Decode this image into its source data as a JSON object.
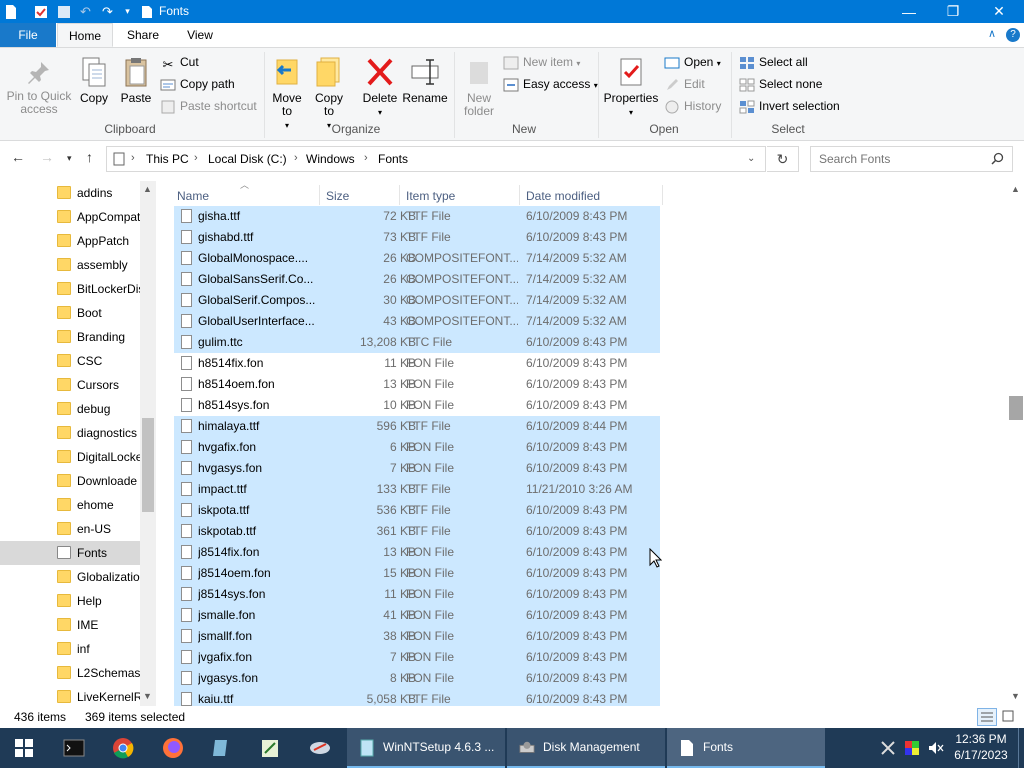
{
  "window": {
    "title": "Fonts",
    "minimize": "—",
    "maximize": "❐",
    "close": "✕"
  },
  "tabs": {
    "file": "File",
    "home": "Home",
    "share": "Share",
    "view": "View"
  },
  "ribbon": {
    "clipboard": {
      "group": "Clipboard",
      "pin": "Pin to Quick access",
      "copy": "Copy",
      "paste": "Paste",
      "cut": "Cut",
      "copy_path": "Copy path",
      "paste_shortcut": "Paste shortcut"
    },
    "organize": {
      "group": "Organize",
      "move_to": "Move to",
      "copy_to": "Copy to",
      "delete": "Delete",
      "rename": "Rename"
    },
    "new": {
      "group": "New",
      "new_folder": "New folder",
      "new_item": "New item",
      "easy_access": "Easy access"
    },
    "open": {
      "group": "Open",
      "properties": "Properties",
      "open": "Open",
      "edit": "Edit",
      "history": "History"
    },
    "select": {
      "group": "Select",
      "select_all": "Select all",
      "select_none": "Select none",
      "invert": "Invert selection"
    }
  },
  "address": {
    "crumbs": [
      "This PC",
      "Local Disk (C:)",
      "Windows",
      "Fonts"
    ]
  },
  "search": {
    "placeholder": "Search Fonts"
  },
  "nav": {
    "items": [
      {
        "label": "addins",
        "type": "folder"
      },
      {
        "label": "AppCompat",
        "type": "folder"
      },
      {
        "label": "AppPatch",
        "type": "folder"
      },
      {
        "label": "assembly",
        "type": "folder"
      },
      {
        "label": "BitLockerDis",
        "type": "folder"
      },
      {
        "label": "Boot",
        "type": "folder"
      },
      {
        "label": "Branding",
        "type": "folder"
      },
      {
        "label": "CSC",
        "type": "folder"
      },
      {
        "label": "Cursors",
        "type": "folder"
      },
      {
        "label": "debug",
        "type": "folder"
      },
      {
        "label": "diagnostics",
        "type": "folder"
      },
      {
        "label": "DigitalLocke",
        "type": "folder"
      },
      {
        "label": "Downloade",
        "type": "folder"
      },
      {
        "label": "ehome",
        "type": "folder"
      },
      {
        "label": "en-US",
        "type": "folder"
      },
      {
        "label": "Fonts",
        "type": "file",
        "selected": true
      },
      {
        "label": "Globalizatio",
        "type": "folder"
      },
      {
        "label": "Help",
        "type": "folder"
      },
      {
        "label": "IME",
        "type": "folder"
      },
      {
        "label": "inf",
        "type": "folder"
      },
      {
        "label": "L2Schemas",
        "type": "folder"
      },
      {
        "label": "LiveKernelR",
        "type": "folder"
      }
    ]
  },
  "columns": {
    "name": "Name",
    "size": "Size",
    "type": "Item type",
    "date": "Date modified"
  },
  "files": [
    {
      "name": "gisha.ttf",
      "size": "72 KB",
      "type": "TTF File",
      "date": "6/10/2009 8:43 PM",
      "selected": true
    },
    {
      "name": "gishabd.ttf",
      "size": "73 KB",
      "type": "TTF File",
      "date": "6/10/2009 8:43 PM",
      "selected": true
    },
    {
      "name": "GlobalMonospace....",
      "size": "26 KB",
      "type": "COMPOSITEFONT...",
      "date": "7/14/2009 5:32 AM",
      "selected": true
    },
    {
      "name": "GlobalSansSerif.Co...",
      "size": "26 KB",
      "type": "COMPOSITEFONT...",
      "date": "7/14/2009 5:32 AM",
      "selected": true
    },
    {
      "name": "GlobalSerif.Compos...",
      "size": "30 KB",
      "type": "COMPOSITEFONT...",
      "date": "7/14/2009 5:32 AM",
      "selected": true
    },
    {
      "name": "GlobalUserInterface...",
      "size": "43 KB",
      "type": "COMPOSITEFONT...",
      "date": "7/14/2009 5:32 AM",
      "selected": true
    },
    {
      "name": "gulim.ttc",
      "size": "13,208 KB",
      "type": "TTC File",
      "date": "6/10/2009 8:43 PM",
      "selected": true
    },
    {
      "name": "h8514fix.fon",
      "size": "11 KB",
      "type": "FON File",
      "date": "6/10/2009 8:43 PM",
      "selected": false
    },
    {
      "name": "h8514oem.fon",
      "size": "13 KB",
      "type": "FON File",
      "date": "6/10/2009 8:43 PM",
      "selected": false
    },
    {
      "name": "h8514sys.fon",
      "size": "10 KB",
      "type": "FON File",
      "date": "6/10/2009 8:43 PM",
      "selected": false
    },
    {
      "name": "himalaya.ttf",
      "size": "596 KB",
      "type": "TTF File",
      "date": "6/10/2009 8:44 PM",
      "selected": true
    },
    {
      "name": "hvgafix.fon",
      "size": "6 KB",
      "type": "FON File",
      "date": "6/10/2009 8:43 PM",
      "selected": true
    },
    {
      "name": "hvgasys.fon",
      "size": "7 KB",
      "type": "FON File",
      "date": "6/10/2009 8:43 PM",
      "selected": true
    },
    {
      "name": "impact.ttf",
      "size": "133 KB",
      "type": "TTF File",
      "date": "11/21/2010 3:26 AM",
      "selected": true
    },
    {
      "name": "iskpota.ttf",
      "size": "536 KB",
      "type": "TTF File",
      "date": "6/10/2009 8:43 PM",
      "selected": true
    },
    {
      "name": "iskpotab.ttf",
      "size": "361 KB",
      "type": "TTF File",
      "date": "6/10/2009 8:43 PM",
      "selected": true
    },
    {
      "name": "j8514fix.fon",
      "size": "13 KB",
      "type": "FON File",
      "date": "6/10/2009 8:43 PM",
      "selected": true
    },
    {
      "name": "j8514oem.fon",
      "size": "15 KB",
      "type": "FON File",
      "date": "6/10/2009 8:43 PM",
      "selected": true
    },
    {
      "name": "j8514sys.fon",
      "size": "11 KB",
      "type": "FON File",
      "date": "6/10/2009 8:43 PM",
      "selected": true
    },
    {
      "name": "jsmalle.fon",
      "size": "41 KB",
      "type": "FON File",
      "date": "6/10/2009 8:43 PM",
      "selected": true
    },
    {
      "name": "jsmallf.fon",
      "size": "38 KB",
      "type": "FON File",
      "date": "6/10/2009 8:43 PM",
      "selected": true
    },
    {
      "name": "jvgafix.fon",
      "size": "7 KB",
      "type": "FON File",
      "date": "6/10/2009 8:43 PM",
      "selected": true
    },
    {
      "name": "jvgasys.fon",
      "size": "8 KB",
      "type": "FON File",
      "date": "6/10/2009 8:43 PM",
      "selected": true
    },
    {
      "name": "kaiu.ttf",
      "size": "5,058 KB",
      "type": "TTF File",
      "date": "6/10/2009 8:43 PM",
      "selected": true
    }
  ],
  "status": {
    "items": "436 items",
    "selected": "369 items selected"
  },
  "taskbar": {
    "apps": [
      {
        "label": "WinNTSetup 4.6.3 ..."
      },
      {
        "label": "Disk Management"
      },
      {
        "label": "Fonts"
      }
    ],
    "time": "12:36 PM",
    "date": "6/17/2023"
  },
  "colors": {
    "accent": "#0078d7",
    "selection": "#cce8ff",
    "folder": "#ffd766",
    "taskbar": "#1f3a56"
  }
}
